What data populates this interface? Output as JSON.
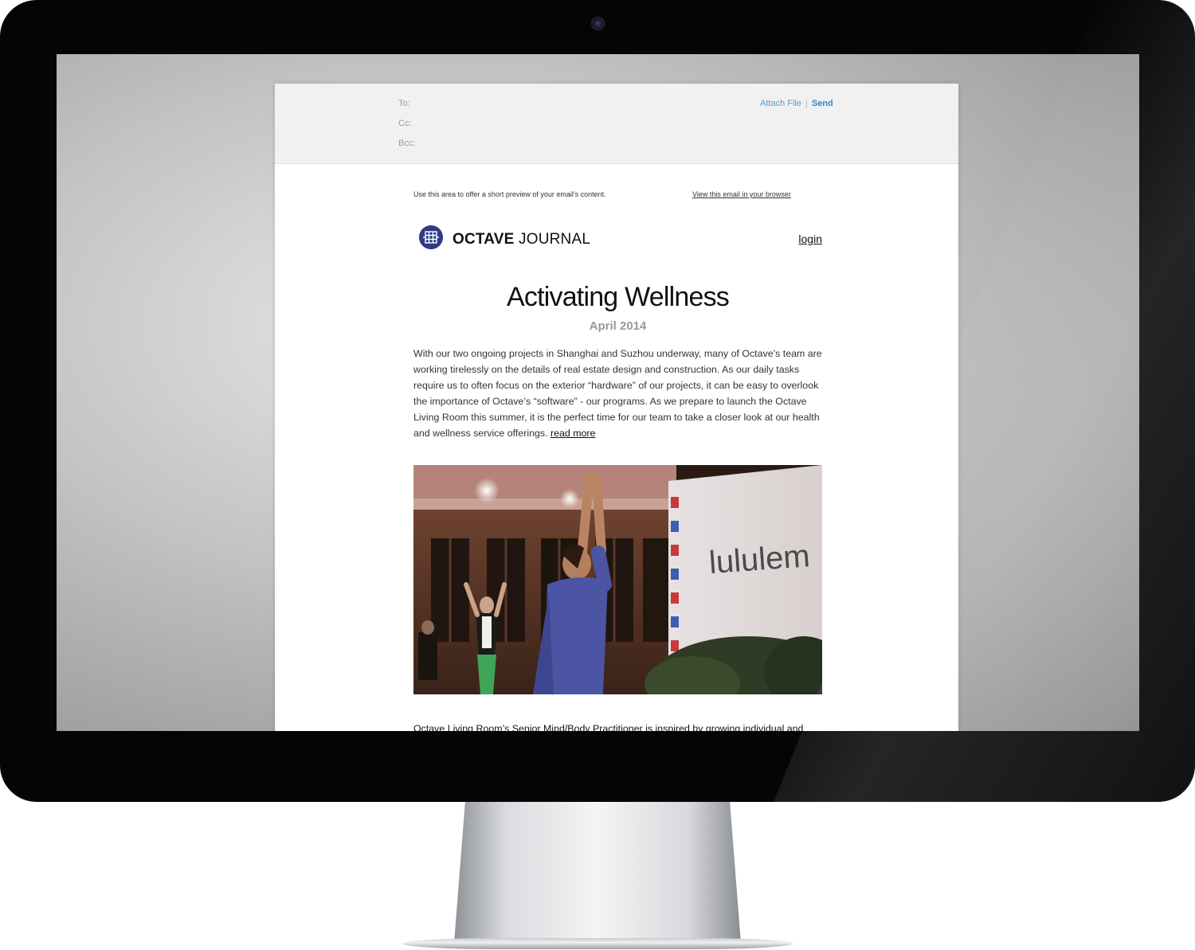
{
  "compose": {
    "to_label": "To:",
    "cc_label": "Cc:",
    "bcc_label": "Bcc:",
    "attach_label": "Attach File",
    "separator": "|",
    "send_label": "Send"
  },
  "email": {
    "preheader": "Use this area to offer a short preview of your email's content.",
    "view_in_browser": "View this email in your browser",
    "brand_bold": "OCTAVE",
    "brand_rest": " JOURNAL",
    "login": "login",
    "title": "Activating Wellness",
    "date": "April 2014",
    "intro": "With our two ongoing projects in Shanghai and Suzhou underway, many of Octave’s team are working tirelessly on the details of real estate design and construction. As our daily tasks require us to often focus on the exterior “hardware” of our projects, it can be easy to overlook the importance of Octave’s “software” - our programs. As we prepare to launch the Octave Living Room this summer, it is the perfect time for our team to take a closer look at our health and wellness service offerings.",
    "read_more": "read more",
    "banner_text": "lululem",
    "second_paragraph": "Octave Living Room’s Senior Mind/Body Practitioner is inspired by growing individual and"
  },
  "colors": {
    "link_blue": "#4a9fd6",
    "send_blue": "#2d8ad0",
    "brand_navy": "#2f3b88",
    "date_gray": "#999999"
  }
}
